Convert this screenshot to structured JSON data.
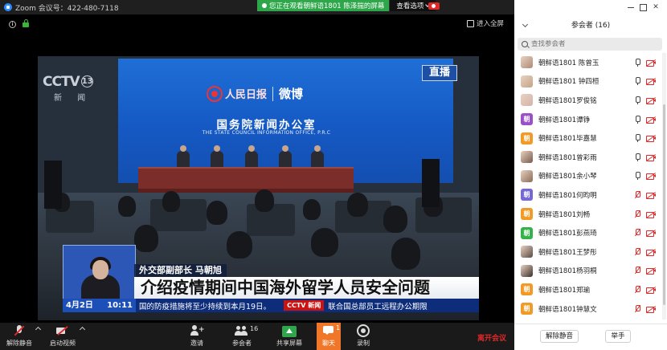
{
  "window": {
    "title": "Zoom 会议号：422-480-7118"
  },
  "banner": {
    "viewing_text": "您正在观看朝鲜语1801 陈泽揣的屏幕",
    "view_options": "查看选项"
  },
  "meeting": {
    "fullscreen_label": "进入全屏"
  },
  "video": {
    "channel": "CCTV",
    "channel_num": "13",
    "channel_sub": "新 闻",
    "partner": "人民日报",
    "partner2": "微博",
    "live_badge": "直播",
    "office_cn": "国务院新闻办公室",
    "office_en": "THE STATE COUNCIL INFORMATION OFFICE, P.R.C",
    "caption_title": "外交部副部长 马朝旭",
    "caption_main": "介绍疫情期间中国海外留学人员安全问题",
    "ticker_date": "4月2日",
    "ticker_time": "10:11",
    "ticker_text": "国的防疫措施将至少持续到本月19日。",
    "ticker_logo": "CCTV 新闻",
    "ticker_text2": "联合国总部员工远程办公期限"
  },
  "toolbar": {
    "mute": "解除静音",
    "video": "启动视频",
    "invite": "邀请",
    "participants": "参会者",
    "participants_count": "16",
    "share": "共享屏幕",
    "chat": "聊天",
    "chat_count": "1",
    "record": "录制",
    "leave": "离开会议"
  },
  "panel": {
    "title": "参会者 (16)",
    "search_placeholder": "查找参会者",
    "unmute_all": "解除静音",
    "raise_hand": "举手",
    "participants": [
      {
        "name": "朝鲜语1801 陈曾玉",
        "avatar": "photo",
        "color": "#b08a76",
        "mic_muted": false
      },
      {
        "name": "朝鲜语1801 钟四桓",
        "avatar": "photo",
        "color": "#c4a484",
        "mic_muted": false
      },
      {
        "name": "朝鲜语1801罗俊铭",
        "avatar": "photo",
        "color": "#d5b3a8",
        "mic_muted": false
      },
      {
        "name": "朝鲜语1801谭铮",
        "avatar": "朝",
        "color": "#9b4fc9",
        "mic_muted": false
      },
      {
        "name": "朝鲜语1801毕嘉慧",
        "avatar": "朝",
        "color": "#f29a26",
        "mic_muted": false
      },
      {
        "name": "朝鲜语1801曾彩雨",
        "avatar": "photo",
        "color": "#7a5a4a",
        "mic_muted": false
      },
      {
        "name": "朝鲜语1801余小琴",
        "avatar": "photo",
        "color": "#8a6a56",
        "mic_muted": false
      },
      {
        "name": "朝鲜语1801何昀明",
        "avatar": "朝",
        "color": "#7468d6",
        "mic_muted": true
      },
      {
        "name": "朝鲜语1801刘畅",
        "avatar": "朝",
        "color": "#f29a26",
        "mic_muted": true
      },
      {
        "name": "朝鲜语1801彭燕琦",
        "avatar": "朝",
        "color": "#34b34a",
        "mic_muted": true
      },
      {
        "name": "朝鲜语1801王梦彤",
        "avatar": "photo",
        "color": "#5a4a42",
        "mic_muted": true
      },
      {
        "name": "朝鲜语1801杨羽桐",
        "avatar": "photo",
        "color": "#3d2f2a",
        "mic_muted": true
      },
      {
        "name": "朝鲜语1801郑瑜",
        "avatar": "朝",
        "color": "#f29a26",
        "mic_muted": true
      },
      {
        "name": "朝鲜语1801钟慧文",
        "avatar": "朝",
        "color": "#f29a26",
        "mic_muted": true
      }
    ]
  }
}
